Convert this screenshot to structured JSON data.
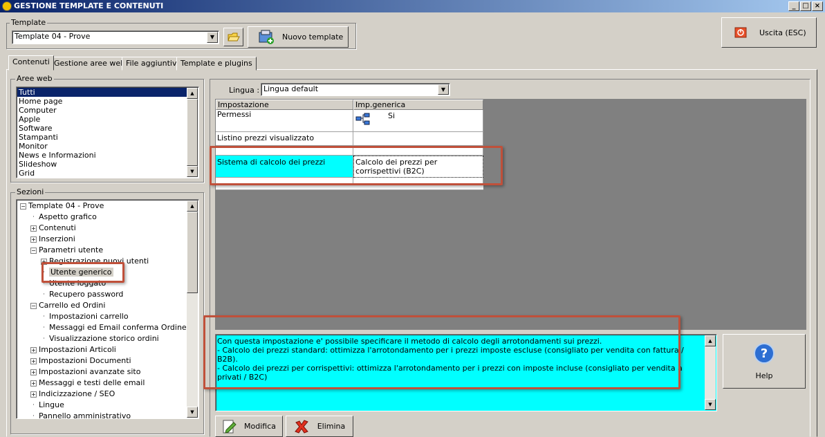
{
  "window": {
    "title": "GESTIONE TEMPLATE E CONTENUTI",
    "minimize": "_",
    "maximize": "□",
    "close": "×"
  },
  "template": {
    "label": "Template",
    "value": "Template 04 - Prove",
    "new_button": "Nuovo template"
  },
  "exit_button": "Uscita (ESC)",
  "tabs": [
    "Contenuti",
    "Gestione aree web",
    "File aggiuntivi",
    "Template e plugins"
  ],
  "aree_web": {
    "label": "Aree web",
    "items": [
      "Tutti",
      "Home page",
      "Computer",
      "Apple",
      "Software",
      "Stampanti",
      "Monitor",
      "News e Informazioni",
      "Slideshow",
      "Grid"
    ],
    "selected": 0
  },
  "sezioni": {
    "label": "Sezioni",
    "nodes": [
      {
        "text": "Template 04 - Prove",
        "level": 0,
        "exp": "-"
      },
      {
        "text": "Aspetto grafico",
        "level": 1,
        "exp": ""
      },
      {
        "text": "Contenuti",
        "level": 1,
        "exp": "+"
      },
      {
        "text": "Inserzioni",
        "level": 1,
        "exp": "+"
      },
      {
        "text": "Parametri utente",
        "level": 1,
        "exp": "-"
      },
      {
        "text": "Registrazione nuovi utenti",
        "level": 2,
        "exp": "+"
      },
      {
        "text": "Utente generico",
        "level": 2,
        "exp": "",
        "sel": true
      },
      {
        "text": "Utente loggato",
        "level": 2,
        "exp": ""
      },
      {
        "text": "Recupero password",
        "level": 2,
        "exp": ""
      },
      {
        "text": "Carrello ed Ordini",
        "level": 1,
        "exp": "-"
      },
      {
        "text": "Impostazioni carrello",
        "level": 2,
        "exp": ""
      },
      {
        "text": "Messaggi ed Email conferma Ordine",
        "level": 2,
        "exp": ""
      },
      {
        "text": "Visualizzazione storico ordini",
        "level": 2,
        "exp": ""
      },
      {
        "text": "Impostazioni Articoli",
        "level": 1,
        "exp": "+"
      },
      {
        "text": "Impostazioni Documenti",
        "level": 1,
        "exp": "+"
      },
      {
        "text": "Impostazioni avanzate sito",
        "level": 1,
        "exp": "+"
      },
      {
        "text": "Messaggi e testi delle email",
        "level": 1,
        "exp": "+"
      },
      {
        "text": "Indicizzazione / SEO",
        "level": 1,
        "exp": "+"
      },
      {
        "text": "Lingue",
        "level": 1,
        "exp": ""
      },
      {
        "text": "Pannello amministrativo",
        "level": 1,
        "exp": ""
      }
    ]
  },
  "lingua": {
    "label": "Lingua :",
    "value": "Lingua default"
  },
  "grid": {
    "headers": [
      "Impostazione",
      "Imp.generica"
    ],
    "rows": [
      {
        "name": "Permessi",
        "value": "Si"
      },
      {
        "name": "Listino prezzi visualizzato",
        "value": ""
      },
      {
        "name": "",
        "value": ""
      },
      {
        "name": "Sistema di calcolo dei prezzi",
        "value": "Calcolo dei prezzi per corrispettivi (B2C)"
      },
      {
        "name": "",
        "value": ""
      }
    ]
  },
  "description": {
    "lines": [
      "Con questa impostazione e' possibile specificare il metodo di calcolo degli arrotondamenti sui prezzi.",
      "- Calcolo dei prezzi standard: ottimizza l'arrotondamento per i prezzi imposte escluse (consigliato per vendita con fattura / B2B).",
      "- Calcolo dei prezzi per corrispettivi: ottimizza l'arrotondamento per i prezzi con imposte incluse (consigliato per vendita a privati / B2C)"
    ]
  },
  "help_button": "Help",
  "modifica_button": "Modifica",
  "elimina_button": "Elimina",
  "colors": {
    "highlight": "#00ffff",
    "selection": "#0a246a",
    "annotation": "#c0503a",
    "grid_bg": "#808080"
  }
}
